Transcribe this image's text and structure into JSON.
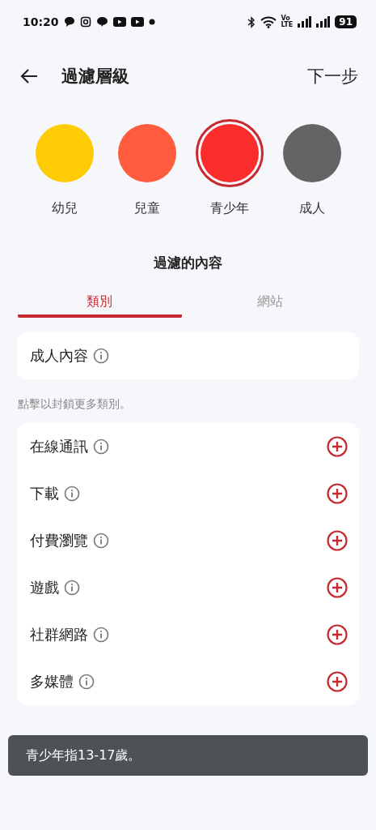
{
  "status_bar": {
    "time": "10:20",
    "network": [
      "Vo",
      "LTE"
    ],
    "battery": "91"
  },
  "header": {
    "title": "過濾層級",
    "next": "下一步"
  },
  "levels": [
    {
      "label": "幼兒",
      "color": "#ffcb05",
      "selected": false
    },
    {
      "label": "兒童",
      "color": "#ff5c3d",
      "selected": false
    },
    {
      "label": "青少年",
      "color": "#fb2c2c",
      "selected": true
    },
    {
      "label": "成人",
      "color": "#646464",
      "selected": false
    }
  ],
  "section_title": "過濾的內容",
  "tabs": [
    {
      "label": "類別",
      "selected": true
    },
    {
      "label": "網站",
      "selected": false
    }
  ],
  "blocked": [
    {
      "label": "成人內容"
    }
  ],
  "hint": "點擊以封鎖更多類別。",
  "categories": [
    {
      "label": "在線通訊"
    },
    {
      "label": "下載"
    },
    {
      "label": "付費瀏覽"
    },
    {
      "label": "遊戲"
    },
    {
      "label": "社群網路"
    },
    {
      "label": "多媒體"
    }
  ],
  "toast": "青少年指13-17歲。"
}
